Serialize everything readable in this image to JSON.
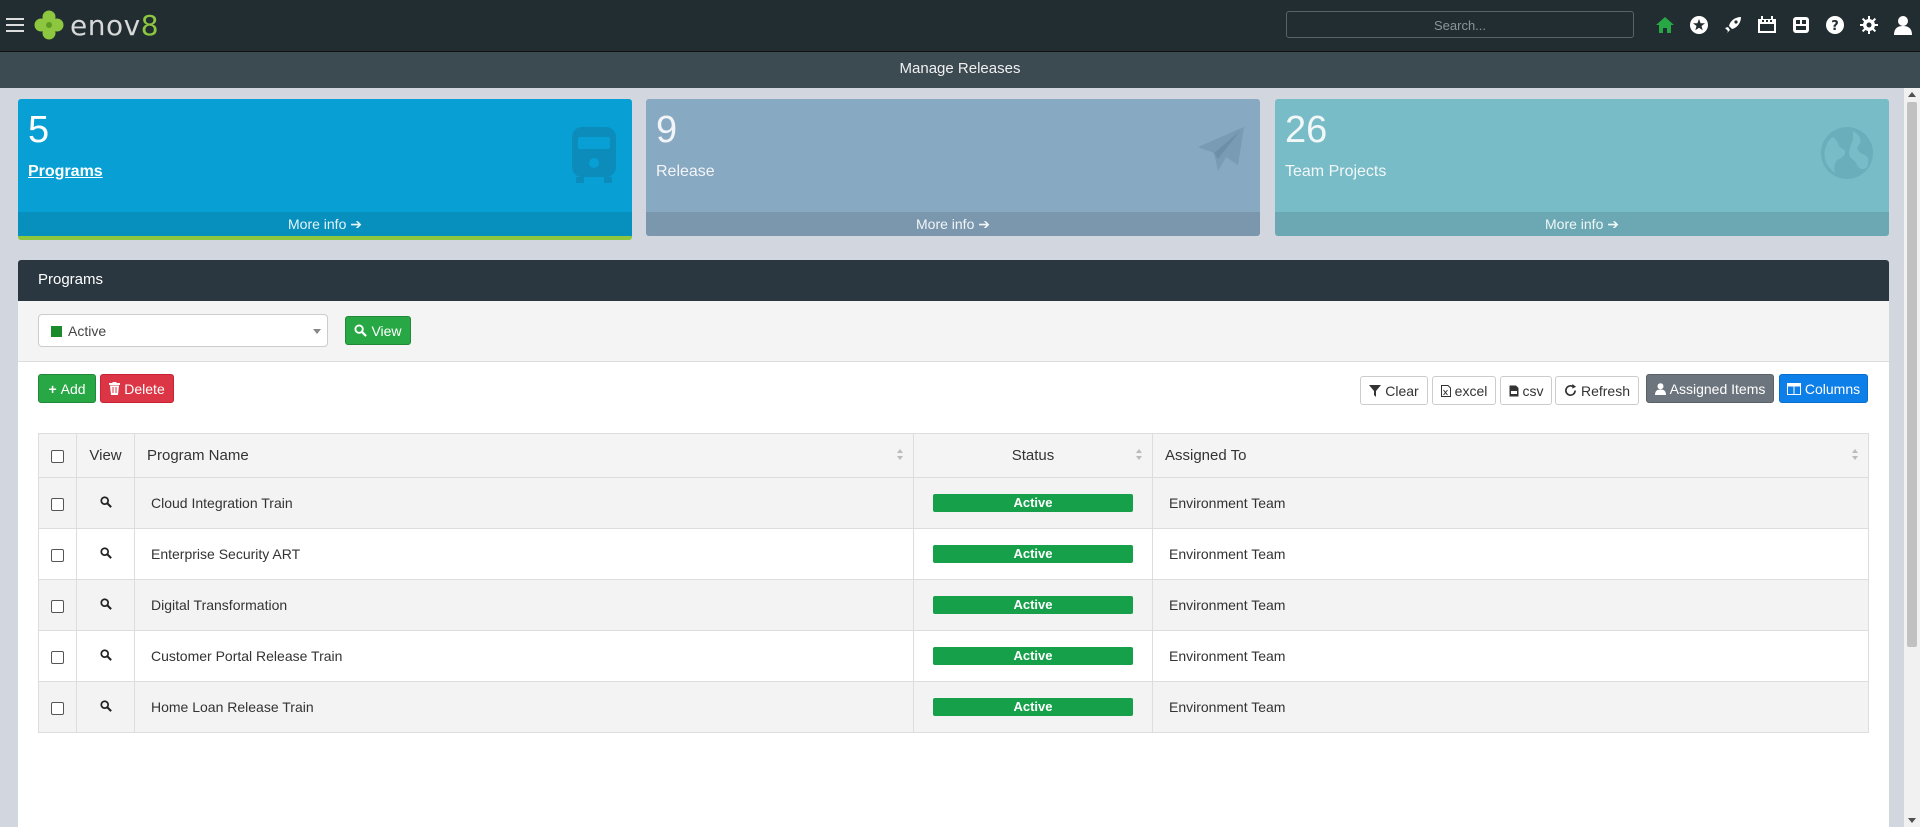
{
  "app": {
    "logo_text": "enov",
    "logo_accent": "8"
  },
  "search": {
    "placeholder": "Search..."
  },
  "top_icons": [
    "home-icon",
    "star-icon",
    "rocket-icon",
    "calendar-icon",
    "dashboard-icon",
    "help-icon",
    "settings-icon",
    "user-icon"
  ],
  "page": {
    "title": "Manage Releases"
  },
  "info_boxes": [
    {
      "count": "5",
      "label": "Programs",
      "more": "More info",
      "icon": "train-icon",
      "color": "#08a0d4"
    },
    {
      "count": "9",
      "label": "Release",
      "more": "More info",
      "icon": "paper-plane-icon",
      "color": "#88a9c2"
    },
    {
      "count": "26",
      "label": "Team Projects",
      "more": "More info",
      "icon": "globe-icon",
      "color": "#78bcc8"
    }
  ],
  "panel": {
    "title": "Programs",
    "filter": {
      "selected": "Active",
      "view_label": "View"
    },
    "toolbar": {
      "add": "Add",
      "delete": "Delete",
      "clear": "Clear",
      "excel": "excel",
      "csv": "csv",
      "refresh": "Refresh",
      "assigned": "Assigned Items",
      "columns": "Columns"
    },
    "columns": [
      "View",
      "Program Name",
      "Status",
      "Assigned To"
    ],
    "rows": [
      {
        "name": "Cloud Integration Train",
        "status": "Active",
        "assigned": "Environment Team"
      },
      {
        "name": "Enterprise Security ART",
        "status": "Active",
        "assigned": "Environment Team"
      },
      {
        "name": "Digital Transformation",
        "status": "Active",
        "assigned": "Environment Team"
      },
      {
        "name": "Customer Portal Release Train",
        "status": "Active",
        "assigned": "Environment Team"
      },
      {
        "name": "Home Loan Release Train",
        "status": "Active",
        "assigned": "Environment Team"
      }
    ]
  },
  "colors": {
    "topbar": "#222d32",
    "status_active": "#16a04a",
    "brand_green": "#8dc63f"
  }
}
